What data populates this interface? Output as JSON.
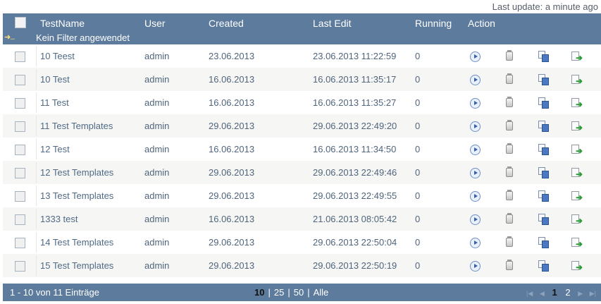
{
  "last_update": "Last update: a minute ago",
  "columns": {
    "name": "TestName",
    "user": "User",
    "created": "Created",
    "last_edit": "Last Edit",
    "running": "Running",
    "action": "Action"
  },
  "filter_status": "Kein Filter angewendet",
  "rows": [
    {
      "name": "10 Teest",
      "user": "admin",
      "created": "23.06.2013",
      "last_edit": "23.06.2013 11:22:59",
      "running": "0"
    },
    {
      "name": "10 Test",
      "user": "admin",
      "created": "16.06.2013",
      "last_edit": "16.06.2013 11:35:17",
      "running": "0"
    },
    {
      "name": "11 Test",
      "user": "admin",
      "created": "16.06.2013",
      "last_edit": "16.06.2013 11:35:27",
      "running": "0"
    },
    {
      "name": "11 Test Templates",
      "user": "admin",
      "created": "29.06.2013",
      "last_edit": "29.06.2013 22:49:20",
      "running": "0"
    },
    {
      "name": "12 Test",
      "user": "admin",
      "created": "16.06.2013",
      "last_edit": "16.06.2013 11:34:50",
      "running": "0"
    },
    {
      "name": "12 Test Templates",
      "user": "admin",
      "created": "29.06.2013",
      "last_edit": "29.06.2013 22:49:46",
      "running": "0"
    },
    {
      "name": "13 Test Templates",
      "user": "admin",
      "created": "29.06.2013",
      "last_edit": "29.06.2013 22:49:55",
      "running": "0"
    },
    {
      "name": "1333 test",
      "user": "admin",
      "created": "16.06.2013",
      "last_edit": "21.06.2013 08:05:42",
      "running": "0"
    },
    {
      "name": "14 Test Templates",
      "user": "admin",
      "created": "29.06.2013",
      "last_edit": "29.06.2013 22:50:04",
      "running": "0"
    },
    {
      "name": "15 Test Templates",
      "user": "admin",
      "created": "29.06.2013",
      "last_edit": "29.06.2013 22:50:19",
      "running": "0"
    }
  ],
  "actions": {
    "icons": [
      "run-icon",
      "delete-icon",
      "copy-icon",
      "export-icon"
    ]
  },
  "footer": {
    "info": "1 - 10 von 11 Einträge",
    "page_sizes": [
      "10",
      "25",
      "50",
      "Alle"
    ],
    "selected_page_size": "10",
    "pages": [
      "1",
      "2"
    ],
    "current_page": "1"
  },
  "colors": {
    "header_bg": "#5d7b9d",
    "alt_row_bg": "#f6f6f4",
    "text": "#506a86"
  }
}
